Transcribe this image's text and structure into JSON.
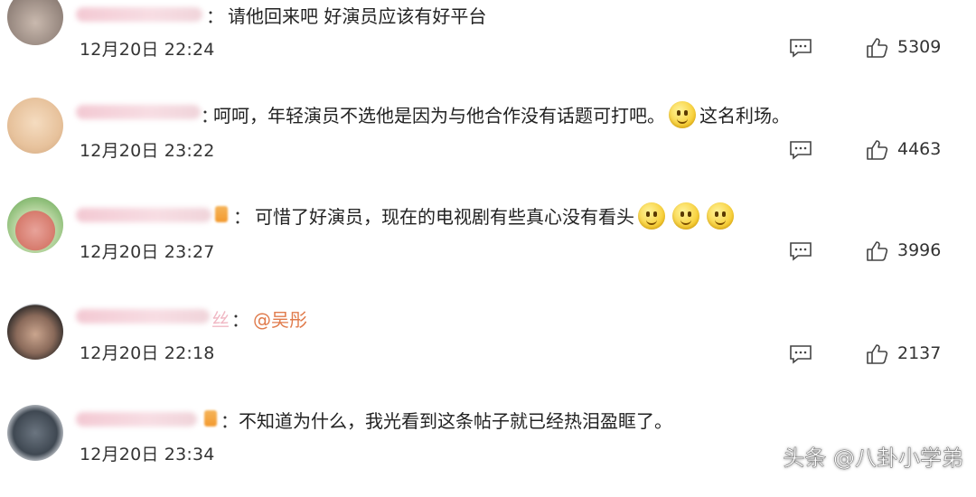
{
  "comments": [
    {
      "text": "请他回来吧 好演员应该有好平台",
      "time": "12月20日 22:24",
      "likes": "5309"
    },
    {
      "text": "呵呵，年轻演员不选他是因为与他合作没有话题可打吧。",
      "text_after": "这名利场。",
      "time": "12月20日 23:22",
      "likes": "4463"
    },
    {
      "text": "可惜了好演员，现在的电视剧有些真心没有看头",
      "time": "12月20日 23:27",
      "likes": "3996"
    },
    {
      "name_suffix": "丝",
      "mention": "@吴彤",
      "time": "12月20日 22:18",
      "likes": "2137"
    },
    {
      "text": "不知道为什么，我光看到这条帖子就已经热泪盈眶了。",
      "time": "12月20日 23:34"
    }
  ],
  "colon": "：",
  "watermark": "头条 @八卦小学弟",
  "icons": {
    "reply": "reply-comment-icon",
    "like": "thumbs-up-icon",
    "emoji": "smile-emoji-icon"
  }
}
